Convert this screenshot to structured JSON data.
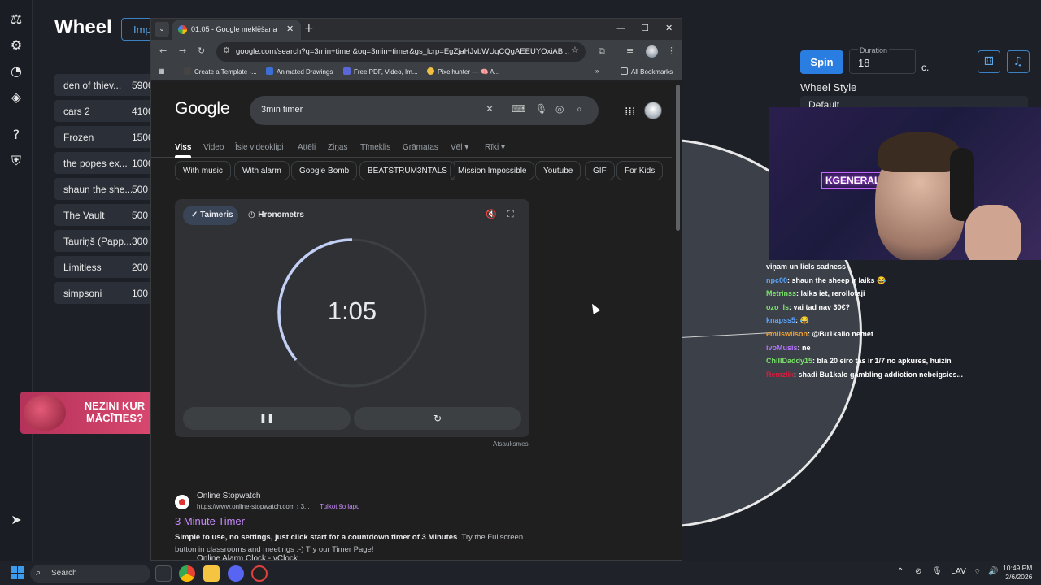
{
  "wheel_app": {
    "title": "Wheel",
    "import_label": "Impo",
    "entries": [
      {
        "name": "den of thiev...",
        "value": "5900"
      },
      {
        "name": "cars 2",
        "value": "4100"
      },
      {
        "name": "Frozen",
        "value": "1500"
      },
      {
        "name": "the popes ex...",
        "value": "1000"
      },
      {
        "name": "shaun the she...",
        "value": "500"
      },
      {
        "name": "The Vault",
        "value": "500"
      },
      {
        "name": "Tauriņš (Papp...",
        "value": "300"
      },
      {
        "name": "Limitless",
        "value": "200"
      },
      {
        "name": "simpsoni",
        "value": "100"
      }
    ],
    "spin_label": "Spin",
    "duration_label": "Duration",
    "duration_value": "18",
    "duration_unit": "c.",
    "wheel_style_label": "Wheel Style",
    "wheel_style_value": "Default",
    "ad_text": "NEZINI KUR MĀCĪTIES?"
  },
  "webcam": {
    "neon_sign": "KGENERALEXE"
  },
  "chat": [
    {
      "user": "",
      "user_color": "#ffffff",
      "message": "viņam un liels sadness"
    },
    {
      "user": "npc00",
      "user_color": "#5aa6ff",
      "message": ": shaun the sheep ir laiks 😂"
    },
    {
      "user": "Metrinss",
      "user_color": "#7be36b",
      "message": ": laiks iet, rerollotaji"
    },
    {
      "user": "ozo_ls",
      "user_color": "#7be36b",
      "message": ": vai tad nav 30€?"
    },
    {
      "user": "knapss5",
      "user_color": "#5aa6ff",
      "message": ": 😂"
    },
    {
      "user": "emilswilson",
      "user_color": "#f0a030",
      "message": ": @Bu1kallo nemet"
    },
    {
      "user": "ivoMusis",
      "user_color": "#b673ff",
      "message": ": ne"
    },
    {
      "user": "ChillDaddy15",
      "user_color": "#7be36b",
      "message": ": bla 20 eiro tas ir 1/7 no apkures, huizin"
    },
    {
      "user": "Remzlik",
      "user_color": "#d02040",
      "message": ": shadi Bu1kalo gambling addiction nebeigsies..."
    }
  ],
  "browser": {
    "tab_title": "01:05 - Google meklēšana",
    "url": "google.com/search?q=3min+timer&oq=3min+timer&gs_lcrp=EgZjaHJvbWUqCQgAEEUYOxiAB...",
    "bookmarks": [
      {
        "label": "Create a Template -...",
        "color": "#444"
      },
      {
        "label": "Animated Drawings",
        "color": "#3b6fd6"
      },
      {
        "label": "Free PDF, Video, Im...",
        "color": "#5a67d8"
      },
      {
        "label": "Pixelhunter — 🧠 A...",
        "color": "#f0c040"
      }
    ],
    "all_bookmarks": "All Bookmarks"
  },
  "google": {
    "logo": "Google",
    "query": "3min timer",
    "tabs": [
      "Viss",
      "Video",
      "Īsie videoklipi",
      "Attēli",
      "Ziņas",
      "Tīmeklis",
      "Grāmatas",
      "Vēl ▾",
      "Rīki ▾"
    ],
    "chips": [
      "With music",
      "With alarm",
      "Google Bomb",
      "BEATSTRUM3NTALS",
      "Mission Impossible",
      "Youtube",
      "GIF",
      "For Kids"
    ],
    "timer": {
      "timer_tab": "✓ Taimeris",
      "stopwatch_tab": "Hronometrs",
      "display": "1:05",
      "remaining_fraction": 0.361,
      "pause_icon": "❚❚",
      "reset_icon": "↻"
    },
    "feedback": "Atsauksmes",
    "result": {
      "site": "Online Stopwatch",
      "url": "https://www.online-stopwatch.com › 3...",
      "translate": "Tulkot šo lapu",
      "title": "3 Minute Timer",
      "snippet_bold": "Simple to use, no settings, just click start for a countdown timer of 3 Minutes",
      "snippet_rest": ". Try the Fullscreen button in classrooms and meetings :-) Try our Timer Page!"
    },
    "next_result_site": "Online Alarm Clock - vClock"
  },
  "taskbar": {
    "search_placeholder": "Search",
    "lang": "LAV",
    "time": "10:49 PM",
    "date": "2/6/2026"
  }
}
